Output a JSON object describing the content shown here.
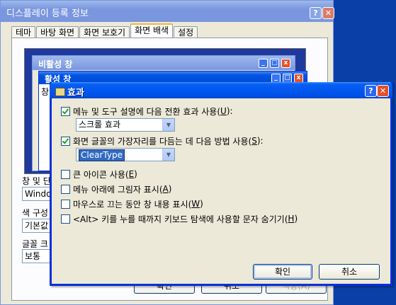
{
  "outer": {
    "title": "디스플레이 등록 정보",
    "tabs": [
      "테마",
      "바탕 화면",
      "화면 보호기",
      "화면 배색",
      "설정"
    ],
    "active_tab": "화면 배색",
    "preview": {
      "inactive_title": "비활성 창",
      "active_title": "활성 창",
      "active_body_fragment": "창"
    },
    "fields": {
      "window_label": "창 및 단",
      "window_value": "Windo",
      "color_label": "색 구성",
      "color_value": "기본값",
      "font_label": "글꼴 크",
      "font_value": "보통"
    },
    "buttons": {
      "ok": "확인",
      "cancel": "취소",
      "apply": "적용(A)"
    }
  },
  "dialog": {
    "title": "효과",
    "options": [
      {
        "label_pre": "메뉴 및 도구 설명에 다음 전환 효과 사용(",
        "key": "U",
        "label_post": "):",
        "checked": true
      },
      {
        "label_pre": "화면 글꼴의 가장자리를 다듬는 데 다음 방법 사용(",
        "key": "S",
        "label_post": "):",
        "checked": true
      },
      {
        "label_pre": "큰 아이콘 사용(",
        "key": "E",
        "label_post": ")",
        "checked": false
      },
      {
        "label_pre": "메뉴 아래에 그림자 표시(",
        "key": "A",
        "label_post": ")",
        "checked": false
      },
      {
        "label_pre": "마우스로 끄는 동안 창 내용 표시(",
        "key": "W",
        "label_post": ")",
        "checked": false
      },
      {
        "label_pre": "<Alt> 키를 누를 때까지 키보드 탐색에 사용할 문자 숨기기(",
        "key": "H",
        "label_post": ")",
        "checked": false
      }
    ],
    "transition_effect": "스크롤 효과",
    "smoothing_method": "ClearType",
    "ok": "확인",
    "cancel": "취소"
  },
  "colors": {
    "title_active": "#0054e3",
    "title_inactive": "#7a96df",
    "face": "#ece9d8",
    "selection": "#316ac5"
  }
}
